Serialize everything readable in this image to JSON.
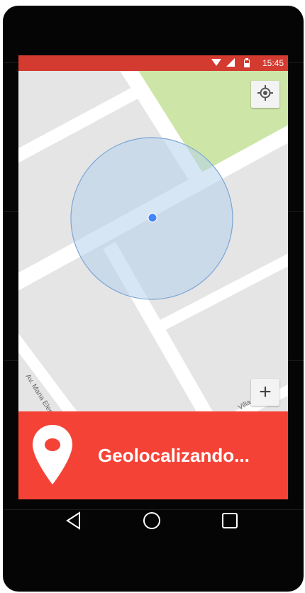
{
  "status_bar": {
    "time": "15:45",
    "icons": [
      "wifi-icon",
      "signal-icon",
      "battery-icon"
    ],
    "color": "#d33b30"
  },
  "map": {
    "labels": {
      "street_left": "Av. Maria Elena",
      "street_right": "Villa Gale"
    },
    "colors": {
      "background": "#e5e5e5",
      "road": "#ffffff",
      "park": "#cde6a8",
      "accuracy_circle": "#b7d2ec",
      "location_dot": "#4285f4"
    },
    "controls": {
      "locate": "my-location-icon",
      "zoom_in": "+"
    }
  },
  "banner": {
    "message": "Geolocalizando...",
    "icon": "map-pin-icon",
    "color": "#f44336"
  },
  "nav_bar": {
    "buttons": [
      "back-icon",
      "home-icon",
      "recents-icon"
    ]
  }
}
